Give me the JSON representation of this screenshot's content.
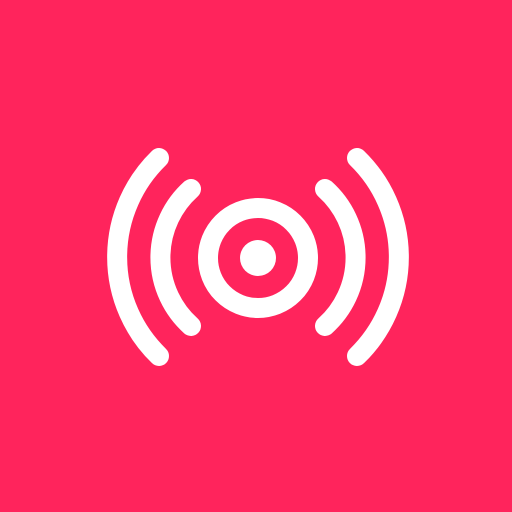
{
  "icon": {
    "name": "broadcast-icon",
    "background_color": "#FF245C",
    "foreground_color": "#FFFFFF"
  }
}
